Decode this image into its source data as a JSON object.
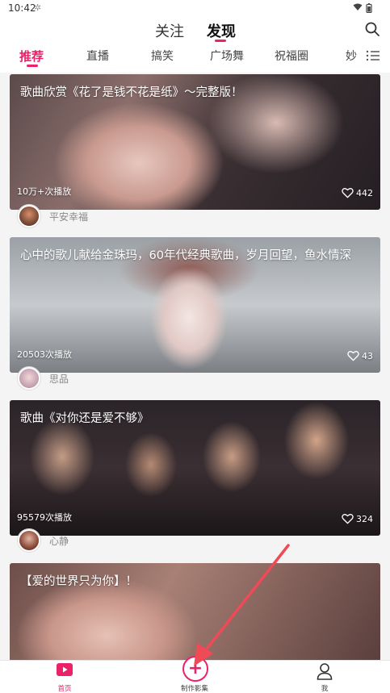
{
  "status_bar": {
    "time": "10:42"
  },
  "header": {
    "tabs": [
      {
        "label": "关注",
        "active": false
      },
      {
        "label": "发现",
        "active": true
      }
    ]
  },
  "categories": [
    {
      "label": "推荐",
      "active": true
    },
    {
      "label": "直播"
    },
    {
      "label": "搞笑"
    },
    {
      "label": "广场舞"
    },
    {
      "label": "祝福圈"
    },
    {
      "label": "妙"
    }
  ],
  "feed": [
    {
      "title": "歌曲欣赏《花了是钱不花是纸》～完整版！",
      "plays": "10万+次播放",
      "likes": "442",
      "author": "平安幸福"
    },
    {
      "title": "心中的歌儿献给金珠玛，60年代经典歌曲，岁月回望，鱼水情深",
      "plays": "20503次播放",
      "likes": "43",
      "author": "思品"
    },
    {
      "title": "歌曲《对你还是爱不够》",
      "plays": "95579次播放",
      "likes": "324",
      "author": "心静"
    },
    {
      "title": "【爱的世界只为你】！"
    }
  ],
  "bottom_nav": [
    {
      "label": "首页",
      "icon": "home-tv-icon",
      "active": true
    },
    {
      "label": "制作影集",
      "icon": "plus-circle-icon"
    },
    {
      "label": "我",
      "icon": "person-icon"
    }
  ],
  "colors": {
    "accent": "#e9226a",
    "annotation": "#f04a57"
  }
}
